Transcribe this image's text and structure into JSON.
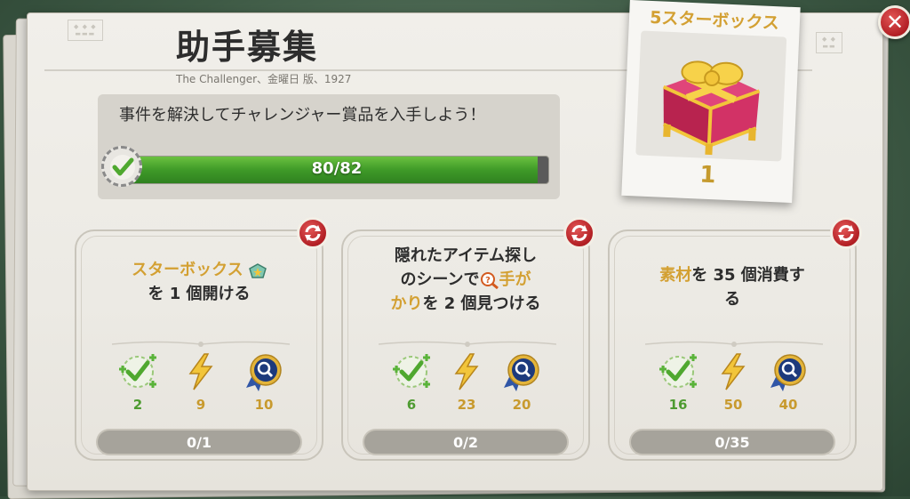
{
  "header": {
    "title": "助手募集",
    "subtitle": "The Challenger、金曜日 版、1927"
  },
  "banner": {
    "text": "事件を解決してチャレンジャー賞品を入手しよう！",
    "progress_text": "80/82",
    "progress_fraction": 0.9756
  },
  "reward": {
    "title": "5スターボックス",
    "count": "1"
  },
  "tasks": [
    {
      "line1_gold": "スターボックス",
      "line2": "を 1 個開ける",
      "rewards": [
        "2",
        "9",
        "10"
      ],
      "progress": "0/1"
    },
    {
      "line1": "隠れたアイテム探し",
      "line2_a": "のシーンで",
      "line2_gold": "手が",
      "line3_gold": "かり",
      "line3_b": "を 2 個見つける",
      "rewards": [
        "6",
        "23",
        "20"
      ],
      "progress": "0/2"
    },
    {
      "line1_gold": "素材",
      "line1_b": "を 35 個消費す",
      "line2": "る",
      "rewards": [
        "16",
        "50",
        "40"
      ],
      "progress": "0/35"
    }
  ],
  "colors": {
    "accent_gold": "#d3a032",
    "progress_green": "#4fa82f",
    "close_red": "#b21f24"
  }
}
